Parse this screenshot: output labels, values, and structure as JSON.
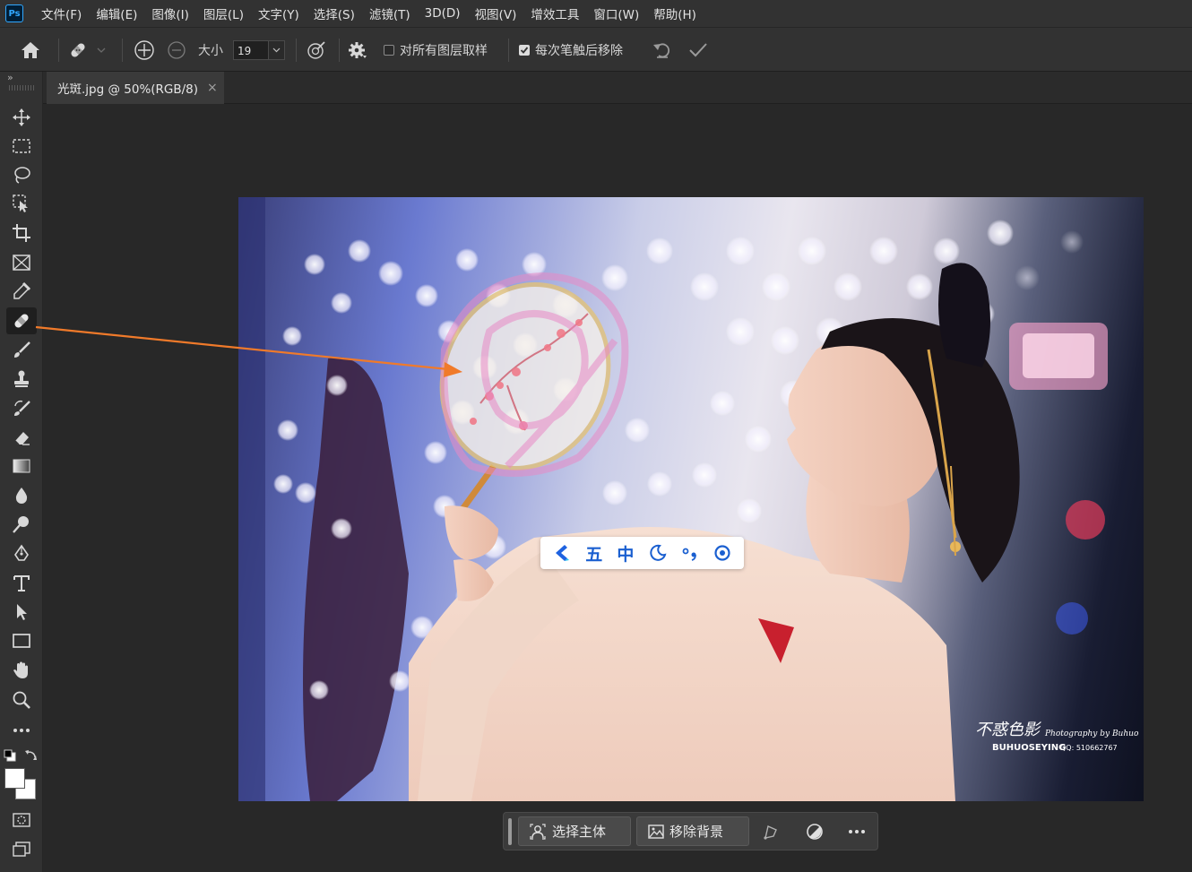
{
  "app": {
    "logo_text": "Ps"
  },
  "menu": [
    "文件(F)",
    "编辑(E)",
    "图像(I)",
    "图层(L)",
    "文字(Y)",
    "选择(S)",
    "滤镜(T)",
    "3D(D)",
    "视图(V)",
    "增效工具",
    "窗口(W)",
    "帮助(H)"
  ],
  "options": {
    "size_label": "大小",
    "size_value": "19",
    "sample_all_layers_label": "对所有图层取样",
    "sample_all_layers_checked": false,
    "remove_after_stroke_label": "每次笔触后移除",
    "remove_after_stroke_checked": true
  },
  "document_tab": {
    "title": "光斑.jpg @ 50%(RGB/8)"
  },
  "photo": {
    "watermark_script": "不惑色影",
    "watermark_credit": "Photography by Buhuo",
    "watermark_brand": "BUHUOSEYING",
    "watermark_qq": "QQ: 510662767"
  },
  "floating_toolbar": {
    "items": [
      "五",
      "中"
    ]
  },
  "taskbar": {
    "select_subject_label": "选择主体",
    "remove_background_label": "移除背景"
  },
  "colors": {
    "accent_arrow": "#f07a2a",
    "ps_blue": "#31a8ff"
  },
  "icons": [
    "home-icon",
    "bandage-icon",
    "crosshair-icon",
    "brush-angle-icon",
    "gear-icon",
    "undo-icon",
    "check-icon"
  ]
}
